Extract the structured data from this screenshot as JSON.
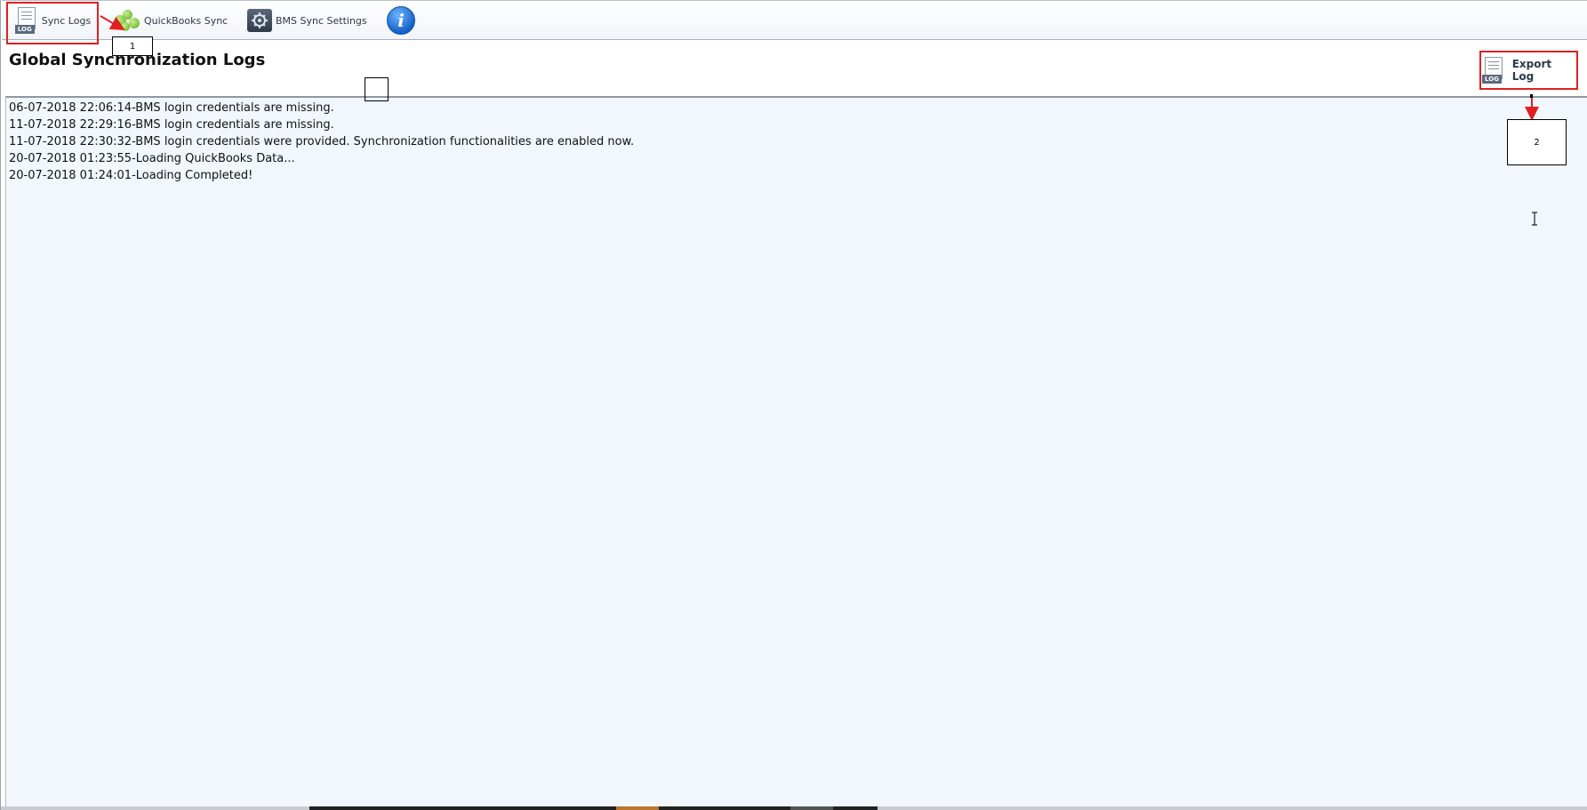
{
  "toolbar": {
    "tabs": [
      {
        "label": "Sync Logs",
        "icon": "log-icon"
      },
      {
        "label": "QuickBooks Sync",
        "icon": "quickbooks-icon"
      },
      {
        "label": "BMS Sync Settings",
        "icon": "settings-icon"
      },
      {
        "label": "",
        "icon": "info-icon"
      }
    ],
    "log_icon_tag": "LOG",
    "info_glyph": "i"
  },
  "page": {
    "title": "Global Synchronization Logs"
  },
  "export": {
    "label": "Export Log",
    "icon_tag": "LOG"
  },
  "log": {
    "lines": [
      "06-07-2018 22:06:14-BMS login credentials are missing.",
      "11-07-2018 22:29:16-BMS login credentials are missing.",
      "11-07-2018 22:30:32-BMS login credentials were provided. Synchronization functionalities are enabled now.",
      "20-07-2018 01:23:55-Loading QuickBooks Data...",
      "20-07-2018 01:24:01-Loading Completed!"
    ]
  },
  "annotations": {
    "callout_1": "1",
    "callout_2": "2",
    "highlight_color": "#e02020"
  }
}
